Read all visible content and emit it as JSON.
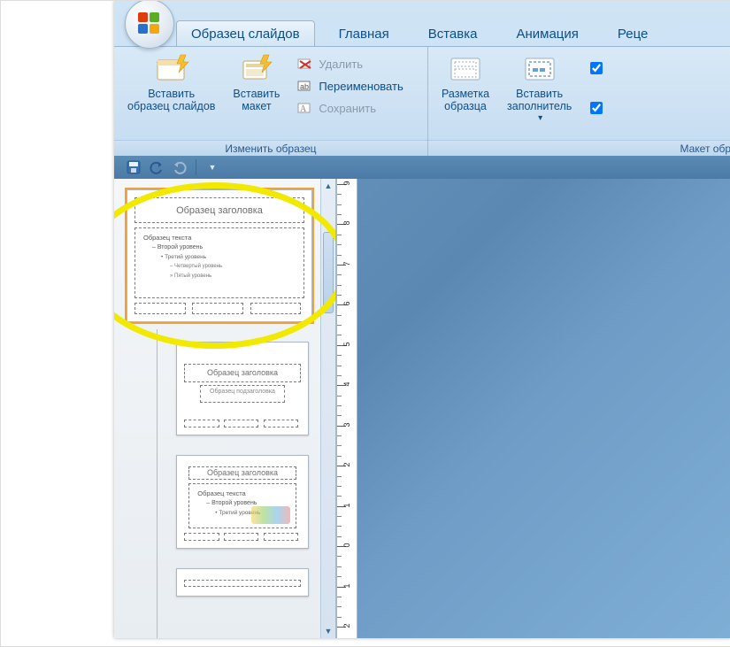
{
  "tabs": {
    "active": "Образец слайдов",
    "others": [
      "Главная",
      "Вставка",
      "Анимация",
      "Реце"
    ]
  },
  "ribbon": {
    "group1": {
      "label": "Изменить образец",
      "insert_master": "Вставить\nобразец слайдов",
      "insert_layout": "Вставить\nмакет",
      "delete": "Удалить",
      "rename": "Переименовать",
      "save": "Сохранить"
    },
    "group2": {
      "label": "Макет обр",
      "page_layout": "Разметка\nобразца",
      "insert_placeholder": "Вставить\nзаполнитель"
    },
    "checks": {
      "c1": true,
      "c2": true
    }
  },
  "master_thumb": {
    "title": "Образец заголовка",
    "l1": "Образец текста",
    "l2": "– Второй уровень",
    "l3": "• Третий уровень",
    "l4": "– Четвертый уровень",
    "l5": "» Пятый уровень"
  },
  "layout2": {
    "title": "Образец заголовка",
    "sub": "Образец подзаголовка"
  },
  "layout3": {
    "title": "Образец заголовка",
    "l1": "Образец текста",
    "l2": "– Второй уровень",
    "l3": "• Третий уровень"
  },
  "ruler": {
    "labels": [
      "9",
      "8",
      "7",
      "6",
      "5",
      "4",
      "3",
      "2",
      "1",
      "0",
      "1",
      "2"
    ]
  },
  "colors": {
    "accent": "#0a4f8c",
    "highlight": "#f2e900"
  }
}
